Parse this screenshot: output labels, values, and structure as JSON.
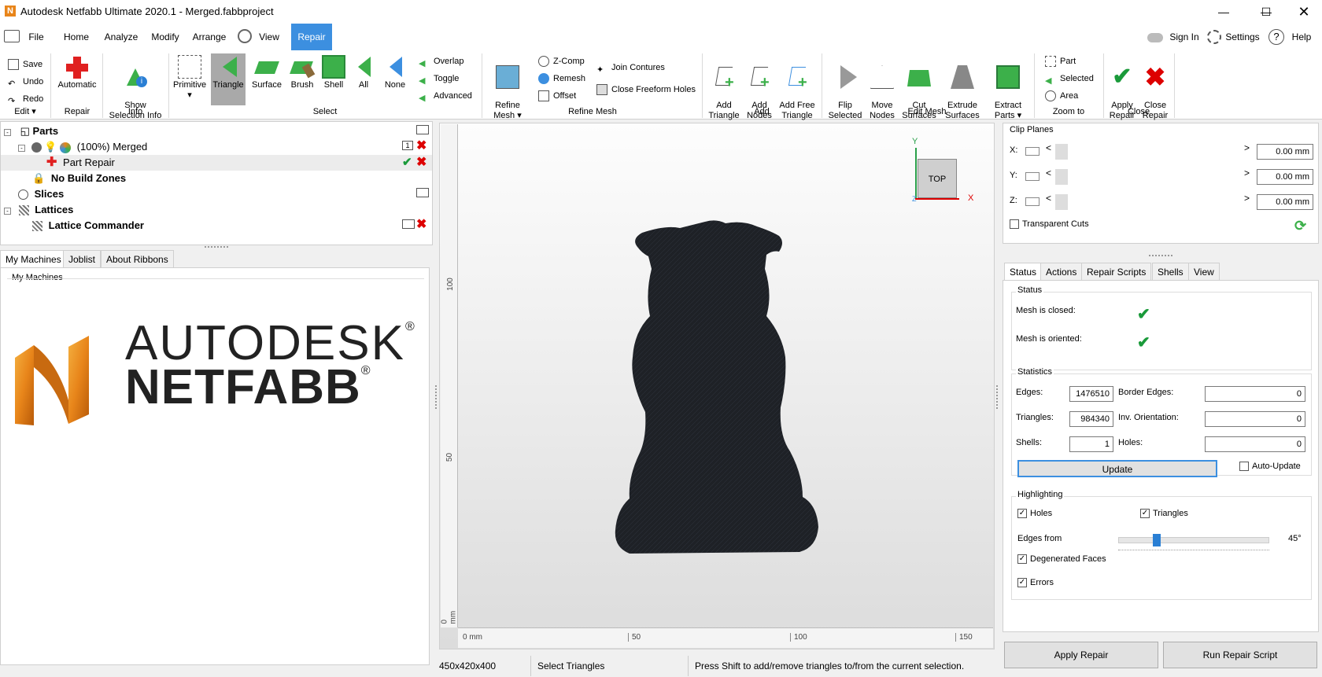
{
  "window": {
    "title": "Autodesk Netfabb Ultimate 2020.1 - Merged.fabbproject",
    "app_icon": "N"
  },
  "menu": {
    "items": [
      "File",
      "Home",
      "Analyze",
      "Modify",
      "Arrange",
      "View",
      "Repair"
    ],
    "active": "Repair",
    "sign_in": "Sign In",
    "settings": "Settings",
    "help": "Help"
  },
  "ribbon": {
    "edit": {
      "save": "Save",
      "undo": "Undo",
      "redo": "Redo",
      "label": "Edit"
    },
    "repair": {
      "automatic": "Automatic",
      "label": "Repair"
    },
    "info": {
      "show_selection_info": "Show\nSelection Info",
      "label": "Info"
    },
    "select": {
      "primitive": "Primitive",
      "triangle": "Triangle",
      "surface": "Surface",
      "brush": "Brush",
      "shell": "Shell",
      "all": "All",
      "none": "None",
      "overlap": "Overlap",
      "toggle": "Toggle",
      "advanced": "Advanced",
      "label": "Select"
    },
    "refine_mesh": {
      "refine_mesh": "Refine\nMesh",
      "zcomp": "Z-Comp",
      "remesh": "Remesh",
      "offset": "Offset",
      "join_contures": "Join Contures",
      "close_freeform_holes": "Close Freeform Holes",
      "label": "Refine Mesh"
    },
    "add": {
      "add_triangle": "Add\nTriangle",
      "add_nodes": "Add\nNodes",
      "add_free_triangle": "Add Free\nTriangle",
      "label": "Add"
    },
    "edit_mesh": {
      "flip_selected": "Flip\nSelected",
      "move_nodes": "Move\nNodes",
      "cut_surfaces": "Cut\nSurfaces",
      "extrude_surfaces": "Extrude\nSurfaces",
      "extract_parts": "Extract\nParts",
      "label": "Edit Mesh"
    },
    "zoom_to": {
      "part": "Part",
      "selected": "Selected",
      "area": "Area",
      "label": "Zoom to"
    },
    "close": {
      "apply_repair": "Apply\nRepair",
      "close_repair": "Close\nRepair",
      "label": "Close"
    }
  },
  "tree": {
    "parts": "Parts",
    "merged": "(100%) Merged",
    "merged_count": "1",
    "part_repair": "Part Repair",
    "no_build_zones": "No Build Zones",
    "slices": "Slices",
    "lattices": "Lattices",
    "lattice_commander": "Lattice Commander"
  },
  "machines": {
    "tabs": [
      "My Machines",
      "Joblist",
      "About Ribbons"
    ],
    "group_label": "My Machines",
    "brand_line1": "AUTODESK",
    "brand_line2": "NETFABB",
    "reg": "®"
  },
  "viewport": {
    "view_cube_label": "TOP",
    "axis_x": "X",
    "axis_y": "Y",
    "axis_z": "Z",
    "ruler_v": [
      "100",
      "50",
      "0 mm"
    ],
    "ruler_h": [
      "0 mm",
      "50",
      "100",
      "150"
    ]
  },
  "statusbar": {
    "dimensions": "450x420x400",
    "mode": "Select Triangles",
    "hint": "Press Shift to add/remove triangles to/from the current selection."
  },
  "clip_planes": {
    "title": "Clip Planes",
    "x_label": "X:",
    "y_label": "Y:",
    "z_label": "Z:",
    "x_value": "0.00 mm",
    "y_value": "0.00 mm",
    "z_value": "0.00 mm",
    "transparent_cuts": "Transparent Cuts"
  },
  "repair_panel": {
    "tabs": [
      "Status",
      "Actions",
      "Repair Scripts",
      "Shells",
      "View"
    ],
    "status_group": "Status",
    "mesh_closed": "Mesh is closed:",
    "mesh_oriented": "Mesh is oriented:",
    "statistics_group": "Statistics",
    "edges_label": "Edges:",
    "edges_value": "1476510",
    "triangles_label": "Triangles:",
    "triangles_value": "984340",
    "shells_label": "Shells:",
    "shells_value": "1",
    "border_edges_label": "Border Edges:",
    "border_edges_value": "0",
    "inv_orientation_label": "Inv. Orientation:",
    "inv_orientation_value": "0",
    "holes_label": "Holes:",
    "holes_value": "0",
    "update": "Update",
    "auto_update": "Auto-Update",
    "highlighting_group": "Highlighting",
    "holes_cb": "Holes",
    "triangles_cb": "Triangles",
    "edges_from": "Edges from",
    "edges_from_value": "45°",
    "edges_from_fraction": 0.25,
    "degenerated_faces": "Degenerated Faces",
    "errors": "Errors",
    "apply_repair": "Apply Repair",
    "run_repair_script": "Run Repair Script"
  },
  "colors": {
    "accent": "#3c8fe0",
    "select_green": "#3cb04a",
    "red": "#d00000",
    "model": "#1e2126",
    "netfabb_orange": "#e8851a"
  }
}
